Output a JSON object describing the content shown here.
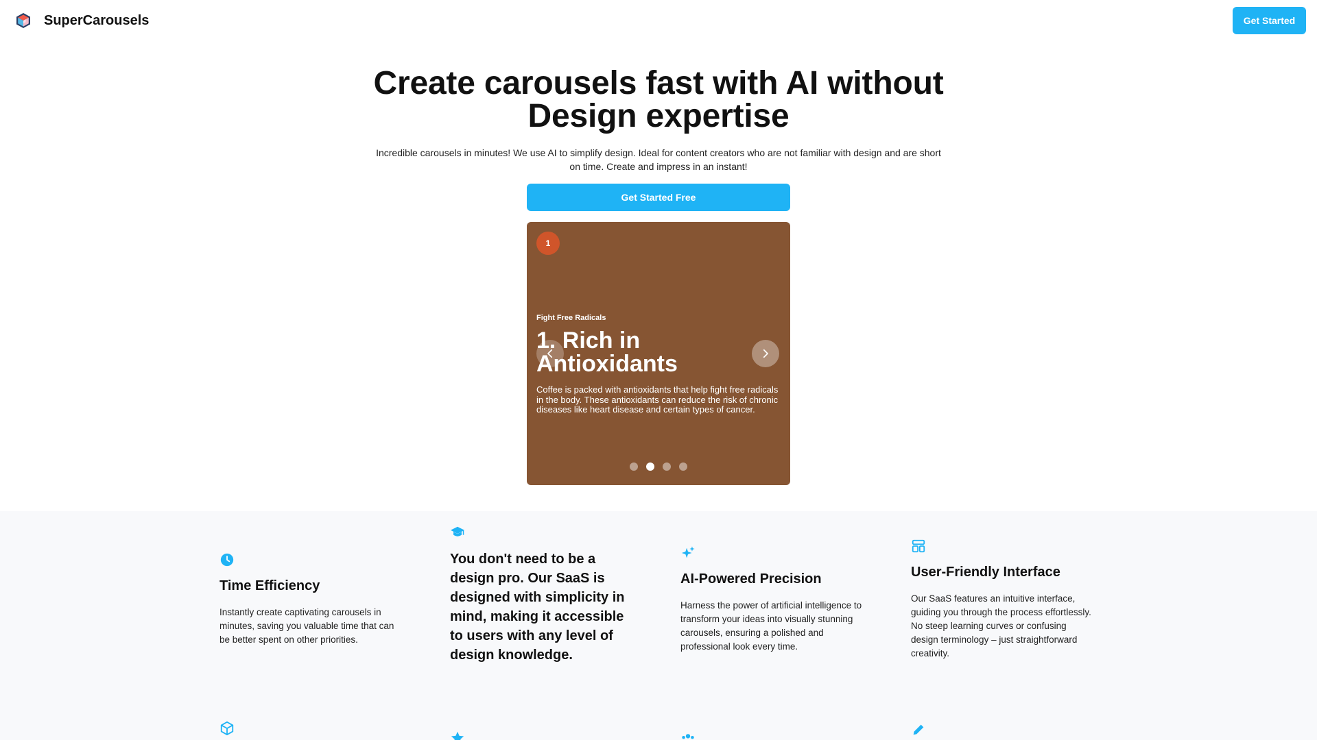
{
  "header": {
    "brand": "SuperCarousels",
    "cta": "Get Started"
  },
  "hero": {
    "title_line1": "Create carousels fast with AI without",
    "title_line2": "Design expertise",
    "subtitle": "Incredible carousels in minutes! We use AI to simplify design. Ideal for content creators who are not familiar with design and are short on time. Create and impress in an instant!",
    "cta": "Get Started Free"
  },
  "carousel": {
    "badge": "1",
    "kicker": "Fight Free Radicals",
    "title": "1. Rich in Antioxidants",
    "body": "Coffee is packed with antioxidants that help fight free radicals in the body. These antioxidants can reduce the risk of chronic diseases like heart disease and certain types of cancer.",
    "background_color": "#865533",
    "badge_color": "#d0552a",
    "total_slides": 4,
    "active_dot": 2
  },
  "features": [
    {
      "icon": "clock-icon",
      "title": "Time Efficiency",
      "description": "Instantly create captivating carousels in minutes, saving you valuable time that can be better spent on other priorities."
    },
    {
      "icon": "graduation-cap-icon",
      "title": "You don't need to be a design pro. Our SaaS is designed with simplicity in mind, making it accessible to users with any level of design knowledge."
    },
    {
      "icon": "sparkles-icon",
      "title": "AI-Powered Precision",
      "description": "Harness the power of artificial intelligence to transform your ideas into visually stunning carousels, ensuring a polished and professional look every time."
    },
    {
      "icon": "layout-icon",
      "title": "User-Friendly Interface",
      "description": "Our SaaS features an intuitive interface, guiding you through the process effortlessly. No steep learning curves or confusing design terminology – just straightforward creativity."
    }
  ],
  "features_row2_icons": [
    "cube-icon",
    "star-icon",
    "users-icon",
    "pencil-icon"
  ],
  "colors": {
    "accent": "#1fb3f5",
    "features_background": "#f8f9fb"
  }
}
